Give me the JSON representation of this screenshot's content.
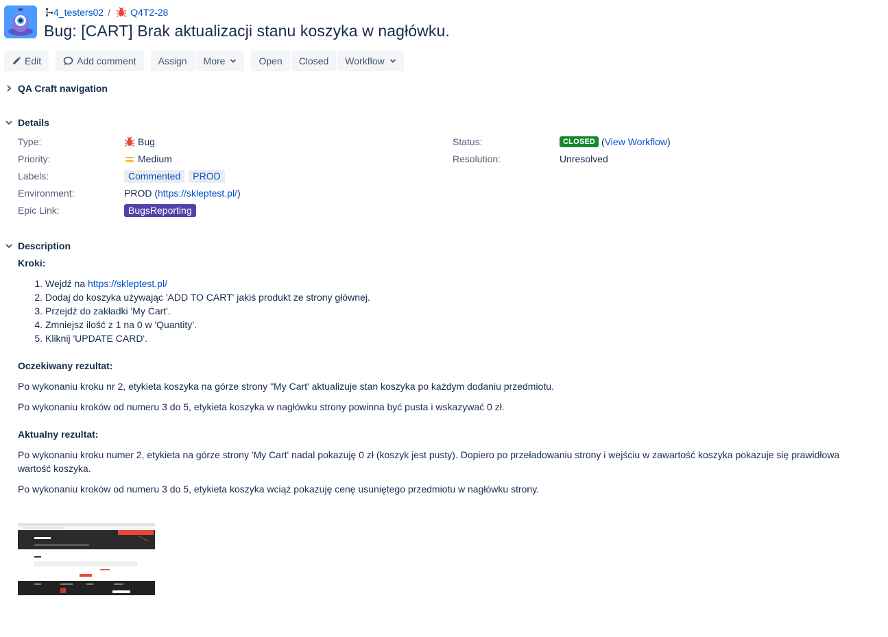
{
  "breadcrumbs": {
    "project": "4_testers02",
    "issue_key": "Q4T2-28"
  },
  "issue": {
    "title": "Bug:  [CART] Brak aktualizacji stanu koszyka w nagłówku."
  },
  "toolbar": {
    "edit": "Edit",
    "add_comment": "Add comment",
    "assign": "Assign",
    "more": "More",
    "open": "Open",
    "closed": "Closed",
    "workflow": "Workflow"
  },
  "sections": {
    "qa_nav": "QA Craft navigation",
    "details": "Details",
    "description": "Description"
  },
  "details": {
    "type_label": "Type:",
    "type_value": "Bug",
    "priority_label": "Priority:",
    "priority_value": "Medium",
    "labels_label": "Labels:",
    "labels": [
      "Commented",
      "PROD"
    ],
    "environment_label": "Environment:",
    "environment_prefix": "PROD (",
    "environment_link": "https://skleptest.pl/",
    "environment_suffix": ")",
    "epic_label": "Epic Link:",
    "epic_value": "BugsReporting",
    "status_label": "Status:",
    "status_value": "CLOSED",
    "view_workflow_open": "(",
    "view_workflow": "View Workflow",
    "view_workflow_close": ")",
    "resolution_label": "Resolution:",
    "resolution_value": "Unresolved"
  },
  "description": {
    "steps_heading": "Kroki:",
    "step1_prefix": "Wejdź na ",
    "step1_link": "https://skleptest.pl/",
    "steps": [
      "Dodaj do koszyka używając 'ADD TO CART' jakiś produkt ze strony głównej.",
      "Przejdź do zakładki 'My Cart'.",
      "Zmniejsz ilość z 1 na 0 w 'Quantity'.",
      "Kliknij 'UPDATE CARD'."
    ],
    "expected_heading": "Oczekiwany rezultat:",
    "expected_1": "Po wykonaniu kroku nr 2, etykieta koszyka na górze strony \"My Cart' aktualizuje stan koszyka po każdym dodaniu przedmiotu.",
    "expected_2": "Po wykonaniu kroków od numeru 3 do 5, etykieta koszyka w nagłówku strony powinna być pusta i wskazywać 0 zł.",
    "actual_heading": "Aktualny rezultat:",
    "actual_1": "Po wykonaniu kroku numer 2, etykieta na górze strony 'My Cart' nadal pokazuję 0 zł (koszyk jest pusty). Dopiero po przeładowaniu strony i wejściu w zawartość koszyka pokazuje się prawidłowa wartość koszyka.",
    "actual_2": "Po wykonaniu kroków od numeru 3 do 5, etykieta koszyka wciąż pokazuję cenę usuniętego przedmiotu w nagłówku strony."
  },
  "colors": {
    "link": "#0052cc",
    "status_closed": "#14892c",
    "epic": "#5243aa",
    "priority_medium": "#ffab00",
    "bug": "#e5493a"
  }
}
